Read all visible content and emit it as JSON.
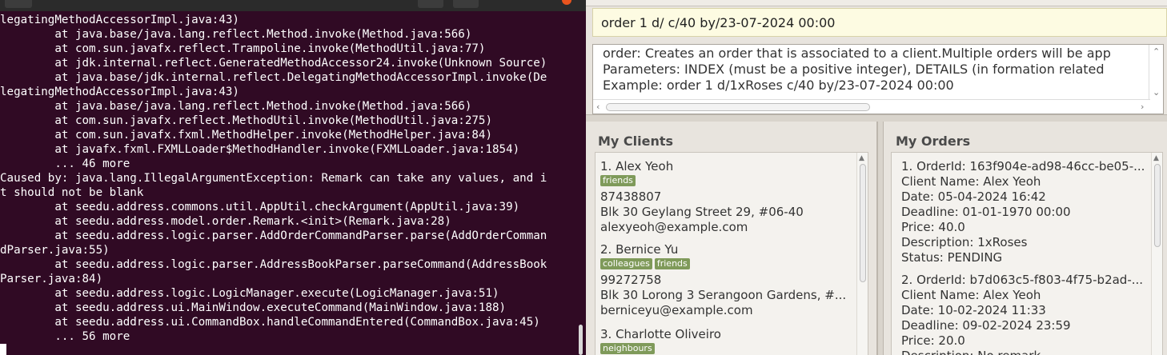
{
  "terminal": {
    "lines": [
      "legatingMethodAccessorImpl.java:43)",
      "        at java.base/java.lang.reflect.Method.invoke(Method.java:566)",
      "        at com.sun.javafx.reflect.Trampoline.invoke(MethodUtil.java:77)",
      "        at jdk.internal.reflect.GeneratedMethodAccessor24.invoke(Unknown Source)",
      "        at java.base/jdk.internal.reflect.DelegatingMethodAccessorImpl.invoke(De",
      "legatingMethodAccessorImpl.java:43)",
      "        at java.base/java.lang.reflect.Method.invoke(Method.java:566)",
      "        at com.sun.javafx.reflect.MethodUtil.invoke(MethodUtil.java:275)",
      "        at com.sun.javafx.fxml.MethodHelper.invoke(MethodHelper.java:84)",
      "        at javafx.fxml.FXMLLoader$MethodHandler.invoke(FXMLLoader.java:1854)",
      "        ... 46 more",
      "Caused by: java.lang.IllegalArgumentException: Remark can take any values, and i",
      "t should not be blank",
      "        at seedu.address.commons.util.AppUtil.checkArgument(AppUtil.java:39)",
      "        at seedu.address.model.order.Remark.<init>(Remark.java:28)",
      "        at seedu.address.logic.parser.AddOrderCommandParser.parse(AddOrderComman",
      "dParser.java:55)",
      "        at seedu.address.logic.parser.AddressBookParser.parseCommand(AddressBook",
      "Parser.java:84)",
      "        at seedu.address.logic.LogicManager.execute(LogicManager.java:51)",
      "        at seedu.address.ui.MainWindow.executeCommand(MainWindow.java:188)",
      "        at seedu.address.ui.CommandBox.handleCommandEntered(CommandBox.java:45)",
      "        ... 56 more"
    ]
  },
  "command_box": {
    "value": "order 1 d/ c/40 by/23-07-2024 00:00"
  },
  "result_display": {
    "lines": [
      "order: Creates an order that is associated to a client.Multiple orders will be app",
      "Parameters: INDEX (must be a positive integer), DETAILS (in formation related",
      "Example: order 1 d/1xRoses c/40 by/23-07-2024 00:00"
    ]
  },
  "clients_panel": {
    "title": "My Clients",
    "clients": [
      {
        "index": "1.",
        "name": "Alex Yeoh",
        "tags": [
          "friends"
        ],
        "phone": "87438807",
        "address": "Blk 30 Geylang Street 29, #06-40",
        "email": "alexyeoh@example.com"
      },
      {
        "index": "2.",
        "name": "Bernice Yu",
        "tags": [
          "colleagues",
          "friends"
        ],
        "phone": "99272758",
        "address": "Blk 30 Lorong 3 Serangoon Gardens, #...",
        "email": "berniceyu@example.com"
      },
      {
        "index": "3.",
        "name": "Charlotte Oliveiro",
        "tags": [
          "neighbours"
        ],
        "phone": "",
        "address": "",
        "email": ""
      }
    ]
  },
  "orders_panel": {
    "title": "My Orders",
    "orders": [
      {
        "header": "1.  OrderId: 163f904e-ad98-46cc-be05-...",
        "client": "Client Name: Alex Yeoh",
        "date": "Date: 05-04-2024 16:42",
        "deadline": "Deadline: 01-01-1970 00:00",
        "price": "Price: 40.0",
        "description": "Description: 1xRoses",
        "status": "Status: PENDING"
      },
      {
        "header": "2.  OrderId: b7d063c5-f803-4f75-b2ad-...",
        "client": "Client Name: Alex Yeoh",
        "date": "Date: 10-02-2024 11:33",
        "deadline": "Deadline: 09-02-2024 23:59",
        "price": "Price: 20.0",
        "description": "Description: No remark",
        "status": ""
      }
    ]
  },
  "colors": {
    "terminal_bg": "#300a24",
    "tag_bg": "#7f9a5a",
    "command_bg": "#fdfbe2"
  }
}
